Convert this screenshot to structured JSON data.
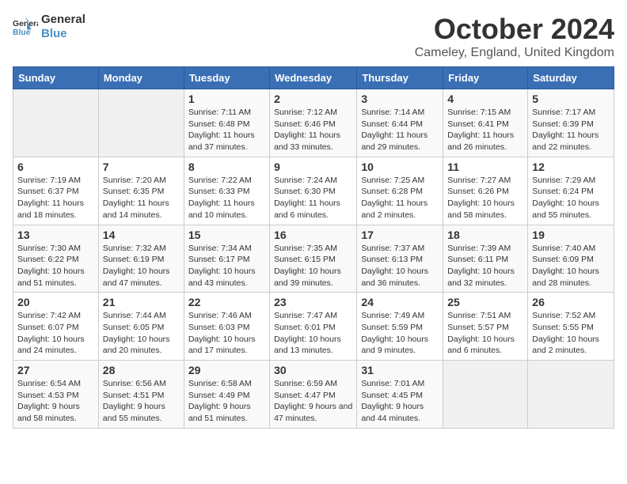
{
  "logo": {
    "line1": "General",
    "line2": "Blue"
  },
  "title": "October 2024",
  "location": "Cameley, England, United Kingdom",
  "days_of_week": [
    "Sunday",
    "Monday",
    "Tuesday",
    "Wednesday",
    "Thursday",
    "Friday",
    "Saturday"
  ],
  "weeks": [
    [
      {
        "day": "",
        "info": ""
      },
      {
        "day": "",
        "info": ""
      },
      {
        "day": "1",
        "info": "Sunrise: 7:11 AM\nSunset: 6:48 PM\nDaylight: 11 hours and 37 minutes."
      },
      {
        "day": "2",
        "info": "Sunrise: 7:12 AM\nSunset: 6:46 PM\nDaylight: 11 hours and 33 minutes."
      },
      {
        "day": "3",
        "info": "Sunrise: 7:14 AM\nSunset: 6:44 PM\nDaylight: 11 hours and 29 minutes."
      },
      {
        "day": "4",
        "info": "Sunrise: 7:15 AM\nSunset: 6:41 PM\nDaylight: 11 hours and 26 minutes."
      },
      {
        "day": "5",
        "info": "Sunrise: 7:17 AM\nSunset: 6:39 PM\nDaylight: 11 hours and 22 minutes."
      }
    ],
    [
      {
        "day": "6",
        "info": "Sunrise: 7:19 AM\nSunset: 6:37 PM\nDaylight: 11 hours and 18 minutes."
      },
      {
        "day": "7",
        "info": "Sunrise: 7:20 AM\nSunset: 6:35 PM\nDaylight: 11 hours and 14 minutes."
      },
      {
        "day": "8",
        "info": "Sunrise: 7:22 AM\nSunset: 6:33 PM\nDaylight: 11 hours and 10 minutes."
      },
      {
        "day": "9",
        "info": "Sunrise: 7:24 AM\nSunset: 6:30 PM\nDaylight: 11 hours and 6 minutes."
      },
      {
        "day": "10",
        "info": "Sunrise: 7:25 AM\nSunset: 6:28 PM\nDaylight: 11 hours and 2 minutes."
      },
      {
        "day": "11",
        "info": "Sunrise: 7:27 AM\nSunset: 6:26 PM\nDaylight: 10 hours and 58 minutes."
      },
      {
        "day": "12",
        "info": "Sunrise: 7:29 AM\nSunset: 6:24 PM\nDaylight: 10 hours and 55 minutes."
      }
    ],
    [
      {
        "day": "13",
        "info": "Sunrise: 7:30 AM\nSunset: 6:22 PM\nDaylight: 10 hours and 51 minutes."
      },
      {
        "day": "14",
        "info": "Sunrise: 7:32 AM\nSunset: 6:19 PM\nDaylight: 10 hours and 47 minutes."
      },
      {
        "day": "15",
        "info": "Sunrise: 7:34 AM\nSunset: 6:17 PM\nDaylight: 10 hours and 43 minutes."
      },
      {
        "day": "16",
        "info": "Sunrise: 7:35 AM\nSunset: 6:15 PM\nDaylight: 10 hours and 39 minutes."
      },
      {
        "day": "17",
        "info": "Sunrise: 7:37 AM\nSunset: 6:13 PM\nDaylight: 10 hours and 36 minutes."
      },
      {
        "day": "18",
        "info": "Sunrise: 7:39 AM\nSunset: 6:11 PM\nDaylight: 10 hours and 32 minutes."
      },
      {
        "day": "19",
        "info": "Sunrise: 7:40 AM\nSunset: 6:09 PM\nDaylight: 10 hours and 28 minutes."
      }
    ],
    [
      {
        "day": "20",
        "info": "Sunrise: 7:42 AM\nSunset: 6:07 PM\nDaylight: 10 hours and 24 minutes."
      },
      {
        "day": "21",
        "info": "Sunrise: 7:44 AM\nSunset: 6:05 PM\nDaylight: 10 hours and 20 minutes."
      },
      {
        "day": "22",
        "info": "Sunrise: 7:46 AM\nSunset: 6:03 PM\nDaylight: 10 hours and 17 minutes."
      },
      {
        "day": "23",
        "info": "Sunrise: 7:47 AM\nSunset: 6:01 PM\nDaylight: 10 hours and 13 minutes."
      },
      {
        "day": "24",
        "info": "Sunrise: 7:49 AM\nSunset: 5:59 PM\nDaylight: 10 hours and 9 minutes."
      },
      {
        "day": "25",
        "info": "Sunrise: 7:51 AM\nSunset: 5:57 PM\nDaylight: 10 hours and 6 minutes."
      },
      {
        "day": "26",
        "info": "Sunrise: 7:52 AM\nSunset: 5:55 PM\nDaylight: 10 hours and 2 minutes."
      }
    ],
    [
      {
        "day": "27",
        "info": "Sunrise: 6:54 AM\nSunset: 4:53 PM\nDaylight: 9 hours and 58 minutes."
      },
      {
        "day": "28",
        "info": "Sunrise: 6:56 AM\nSunset: 4:51 PM\nDaylight: 9 hours and 55 minutes."
      },
      {
        "day": "29",
        "info": "Sunrise: 6:58 AM\nSunset: 4:49 PM\nDaylight: 9 hours and 51 minutes."
      },
      {
        "day": "30",
        "info": "Sunrise: 6:59 AM\nSunset: 4:47 PM\nDaylight: 9 hours and 47 minutes."
      },
      {
        "day": "31",
        "info": "Sunrise: 7:01 AM\nSunset: 4:45 PM\nDaylight: 9 hours and 44 minutes."
      },
      {
        "day": "",
        "info": ""
      },
      {
        "day": "",
        "info": ""
      }
    ]
  ]
}
